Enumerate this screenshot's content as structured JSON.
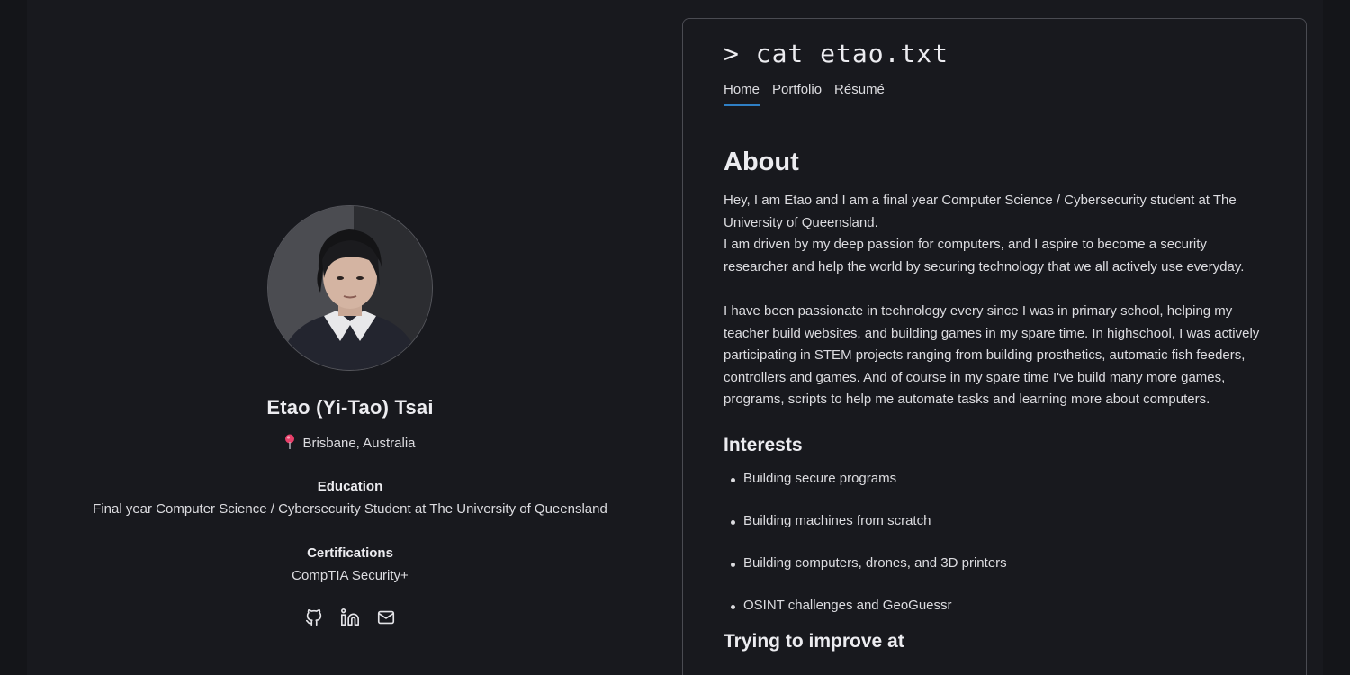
{
  "profile": {
    "name": "Etao (Yi-Tao) Tsai",
    "location": "Brisbane, Australia",
    "education_heading": "Education",
    "education_value": "Final year Computer Science / Cybersecurity Student at The University of Queensland",
    "certifications_heading": "Certifications",
    "certifications_value": "CompTIA Security+",
    "socials": [
      {
        "icon": "github-icon"
      },
      {
        "icon": "linkedin-icon"
      },
      {
        "icon": "mail-icon"
      }
    ]
  },
  "card": {
    "terminal_title": "> cat etao.txt",
    "tabs": [
      {
        "label": "Home",
        "active": true
      },
      {
        "label": "Portfolio",
        "active": false
      },
      {
        "label": "Résumé",
        "active": false
      }
    ],
    "about_heading": "About",
    "about_p1_line1": "Hey, I am Etao and I am a final year Computer Science / Cybersecurity student at The University of Queensland.",
    "about_p1_line2": "I am driven by my deep passion for computers, and I aspire to become a security researcher and help the world by securing technology that we all actively use everyday.",
    "about_p2": "I have been passionate in technology every since I was in primary school, helping my teacher build websites, and building games in my spare time. In highschool, I was actively participating in STEM projects ranging from building prosthetics, automatic fish feeders, controllers and games. And of course in my spare time I've build many more games, programs, scripts to help me automate tasks and learning more about computers.",
    "interests_heading": "Interests",
    "interests": [
      "Building secure programs",
      "Building machines from scratch",
      "Building computers, drones, and 3D printers",
      "OSINT challenges and GeoGuessr"
    ],
    "improve_heading": "Trying to improve at"
  },
  "colors": {
    "background": "#18191e",
    "accent": "#2f7fc4",
    "border": "#4a4b52"
  }
}
